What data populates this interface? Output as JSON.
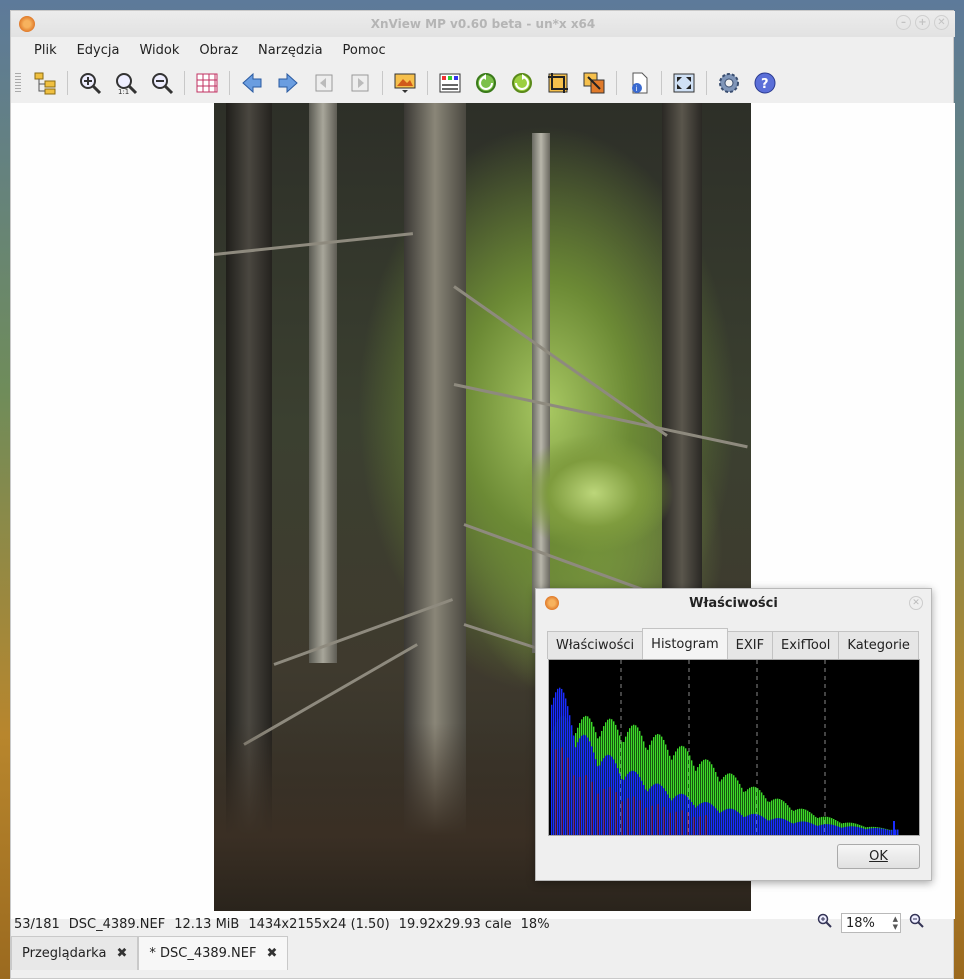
{
  "window": {
    "title": "XnView MP v0.60 beta - un*x x64"
  },
  "menu": [
    "Plik",
    "Edycja",
    "Widok",
    "Obraz",
    "Narzędzia",
    "Pomoc"
  ],
  "toolbar": {
    "icons": [
      "browser-tree-icon",
      "zoom-in-icon",
      "zoom-actual-icon",
      "zoom-out-icon",
      "grid-icon",
      "previous-arrow-icon",
      "next-arrow-icon",
      "first-page-icon",
      "last-page-icon",
      "slideshow-icon",
      "color-adjust-icon",
      "rotate-left-icon",
      "rotate-right-icon",
      "crop-icon",
      "resize-icon",
      "file-info-icon",
      "fullscreen-icon",
      "settings-gear-icon",
      "help-icon"
    ]
  },
  "status": {
    "index": "53/181",
    "filename": "DSC_4389.NEF",
    "size": "12.13 MiB",
    "dimensions": "1434x2155x24 (1.50)",
    "print_size": "19.92x29.93 cale",
    "zoom": "18%"
  },
  "zoom_control": {
    "value": "18%"
  },
  "tabs": [
    {
      "label": "Przeglądarka",
      "active": false
    },
    {
      "label": "* DSC_4389.NEF",
      "active": true
    }
  ],
  "dialog": {
    "title": "Właściwości",
    "tabs": [
      "Właściwości",
      "Histogram",
      "EXIF",
      "ExifTool",
      "Kategorie"
    ],
    "active_tab": "Histogram",
    "ok_label": "OK"
  },
  "histogram": {
    "background": "#000000",
    "colors": {
      "blue": "#1a2cff",
      "green": "#3ddb2a",
      "red": "#c0271c"
    }
  }
}
